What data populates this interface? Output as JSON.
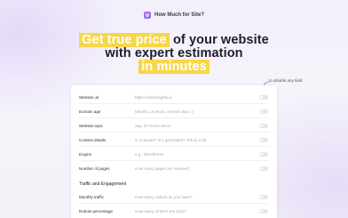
{
  "brand": {
    "name": "How Much for Site?",
    "logo_icon": "app-logo-icon"
  },
  "hero": {
    "line1_highlight": "Get true price",
    "line1_rest": " of your website",
    "line2": "with expert estimation",
    "line3_highlight": "in minutes"
  },
  "annotation": "to disable any field",
  "colors": {
    "highlight": "#f7d64a",
    "accent": "#9b6cf0"
  },
  "fields": [
    {
      "label": "Website url",
      "placeholder": "https://webinsights.io"
    },
    {
      "label": "Domain age",
      "placeholder": "Months, or years, or even days :)"
    },
    {
      "label": "Website topic",
      "placeholder": "Say, it's home decor"
    },
    {
      "label": "Content details",
      "placeholder": "Is it unique? Is it generated? Tell us a bit"
    },
    {
      "label": "Engine",
      "placeholder": "e.g., WordPress"
    },
    {
      "label": "Number of pages",
      "placeholder": "How many pages are indexed?"
    }
  ],
  "section2": {
    "title": "Traffic and Engagement",
    "fields": [
      {
        "label": "Monthly traffic",
        "placeholder": "How many visitors do you have?"
      },
      {
        "label": "Robots percentage",
        "placeholder": "How many of them are bots?"
      }
    ]
  }
}
